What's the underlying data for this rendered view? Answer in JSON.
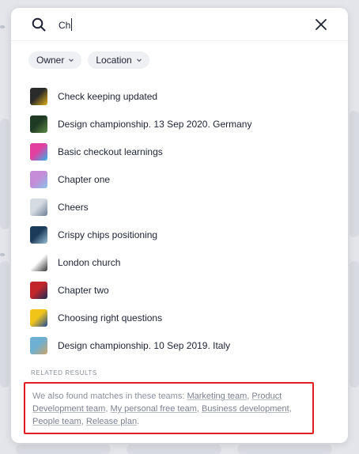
{
  "search": {
    "value": "Ch"
  },
  "filters": [
    {
      "label": "Owner",
      "icon": "chevron-down-icon"
    },
    {
      "label": "Location",
      "icon": "chevron-down-icon"
    }
  ],
  "results": [
    {
      "label": "Check keeping updated",
      "thumb_colors": [
        "#2b2b2b",
        "#e3b116"
      ]
    },
    {
      "label": "Design championship. 13 Sep 2020. Germany",
      "thumb_colors": [
        "#1f3a22",
        "#5e8a4a"
      ]
    },
    {
      "label": "Basic checkout learnings",
      "thumb_colors": [
        "#e33fa0",
        "#2fb4e8"
      ]
    },
    {
      "label": "Chapter one",
      "thumb_colors": [
        "#c48bd6",
        "#8bc3e8"
      ]
    },
    {
      "label": "Cheers",
      "thumb_colors": [
        "#d5dbe3",
        "#6d7f93"
      ]
    },
    {
      "label": "Crispy chips positioning",
      "thumb_colors": [
        "#1c3a5a",
        "#9cc2d8"
      ]
    },
    {
      "label": "London church",
      "thumb_colors": [
        "#ffffff",
        "#333333"
      ]
    },
    {
      "label": "Chapter two",
      "thumb_colors": [
        "#c3262a",
        "#1b2a57"
      ]
    },
    {
      "label": "Choosing right questions",
      "thumb_colors": [
        "#f0c419",
        "#1c4aa0"
      ]
    },
    {
      "label": "Design championship. 10 Sep 2019. Italy",
      "thumb_colors": [
        "#6eb0d2",
        "#c9a46a"
      ]
    }
  ],
  "related": {
    "heading": "RELATED RESULTS",
    "intro": "We also found matches in these teams: ",
    "teams": [
      "Marketing team",
      "Product Development team",
      "My personal free team",
      "Business development",
      "People team",
      "Release plan"
    ]
  }
}
